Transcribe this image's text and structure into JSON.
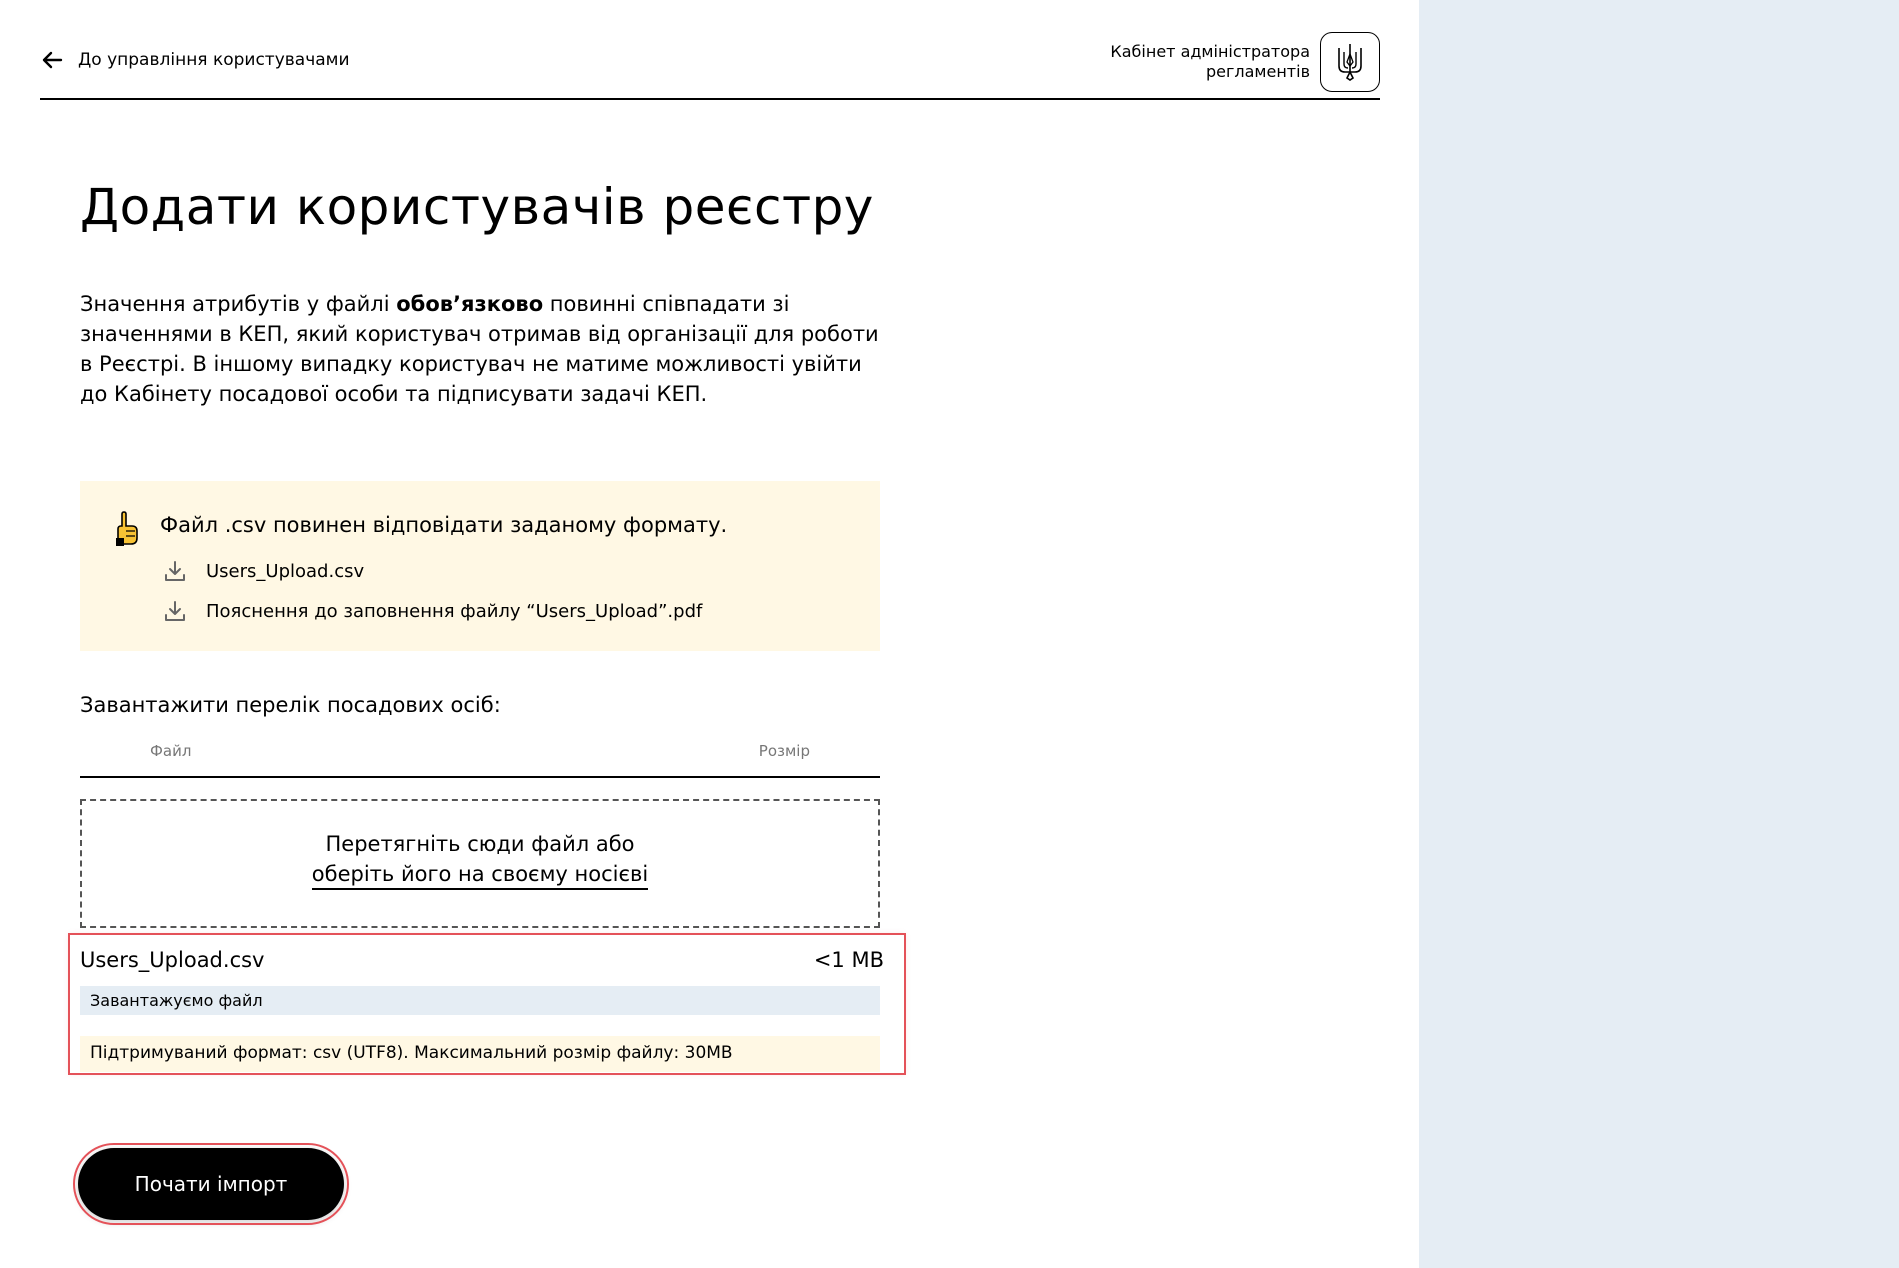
{
  "header": {
    "back_label": "До управління користувачами",
    "brand_title_line1": "Кабінет адміністратора",
    "brand_title_line2": "регламентів",
    "logo_icon": "trident-icon",
    "back_icon": "arrow-left-icon"
  },
  "page": {
    "title": "Додати користувачів реєстру",
    "intro_before": "Значення атрибутів у файлі ",
    "intro_bold": "обов’язково",
    "intro_after": " повинні співпадати зі значеннями в КЕП, який користувач отримав від організації для роботи в Реєстрі. В іншому випадку користувач не матиме можливості увійти до Кабінету посадової особи та підписувати задачі КЕП."
  },
  "notice": {
    "icon": "pointing-hand-icon",
    "headline": "Файл .csv повинен відповідати заданому формату.",
    "downloads": [
      {
        "label": "Users_Upload.csv",
        "icon": "download-icon"
      },
      {
        "label": "Пояснення до заповнення файлу “Users_Upload”.pdf",
        "icon": "download-icon"
      }
    ]
  },
  "upload": {
    "label": "Завантажити перелік посадових осіб:",
    "col_file": "Файл",
    "col_size": "Розмір",
    "drop_line1": "Перетягніть сюди файл або",
    "drop_line2": "оберіть його на своєму носієві"
  },
  "file": {
    "name": "Users_Upload.csv",
    "size": "<1 MB",
    "status": "Завантажуємо файл",
    "hint": "Підтримуваний формат: csv (UTF8). Максимальний розмір файлу: 30MB"
  },
  "actions": {
    "start_label": "Почати імпорт"
  },
  "colors": {
    "notice_bg": "#fff8e4",
    "right_panel_bg": "#e5edf4",
    "highlight": "#e45259"
  }
}
